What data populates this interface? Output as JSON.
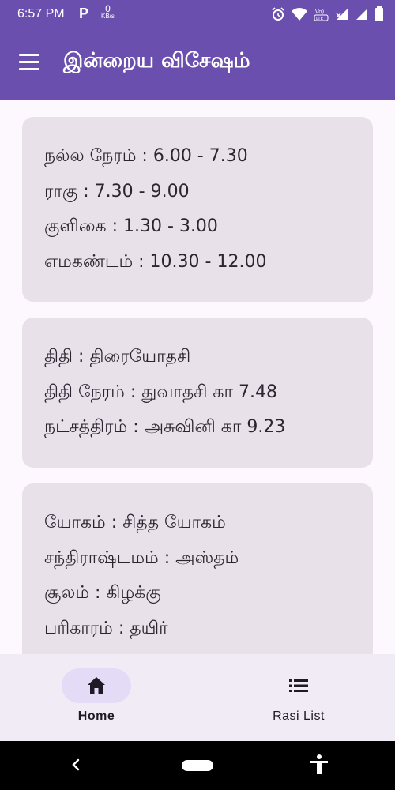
{
  "status_bar": {
    "time": "6:57 PM",
    "p_label": "P",
    "speed_value": "0",
    "speed_unit": "KB/s",
    "icons": [
      "alarm-icon",
      "wifi-icon",
      "volte-icon",
      "signal-icon",
      "signal-icon",
      "battery-icon"
    ]
  },
  "app_bar": {
    "title": "இன்றைய விசேஷம்",
    "menu_icon": "hamburger-menu-icon"
  },
  "cards": [
    {
      "lines": [
        "நல்ல நேரம் : 6.00 - 7.30",
        "ராகு : 7.30 - 9.00",
        "குளிகை : 1.30 - 3.00",
        "எமகண்டம் : 10.30 - 12.00"
      ]
    },
    {
      "lines": [
        "திதி : திரையோதசி",
        "திதி நேரம் : துவாதசி கா 7.48",
        "நட்சத்திரம் : அசுவினி கா 9.23"
      ]
    },
    {
      "lines": [
        "யோகம் : சித்த யோகம்",
        "சந்திராஷ்டமம் : அஸ்தம்",
        "சூலம் : கிழக்கு",
        "பரிகாரம் : தயிர்"
      ]
    }
  ],
  "bottom_nav": {
    "home_label": "Home",
    "rasi_label": "Rasi List",
    "active_color": "#e4dcf6"
  },
  "colors": {
    "primary": "#6a4fae",
    "card_bg": "#e8e1ea",
    "page_bg": "#fdf8fd"
  }
}
